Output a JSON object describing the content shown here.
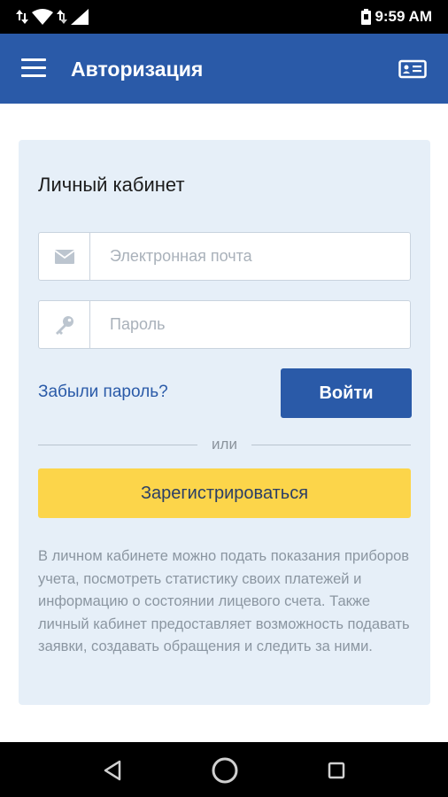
{
  "status_bar": {
    "time": "9:59 AM",
    "icons": [
      "data-arrows-icon",
      "wifi-icon",
      "signal-icon",
      "battery-icon"
    ]
  },
  "app_bar": {
    "title": "Авторизация",
    "menu_icon": "hamburger-menu-icon",
    "action_icon": "id-card-icon",
    "background": "#2a5aa8"
  },
  "login_panel": {
    "title": "Личный кабинет",
    "email": {
      "placeholder": "Электронная почта",
      "value": "",
      "icon": "envelope-icon"
    },
    "password": {
      "placeholder": "Пароль",
      "value": "",
      "icon": "key-icon"
    },
    "forgot_link": "Забыли пароль?",
    "login_button": "Войти",
    "divider_text": "или",
    "register_button": "Зарегистрироваться",
    "info_text": "В личном кабинете можно подать показания приборов учета, посмотреть статистику своих платежей и информацию о состоянии лицевого счета. Также личный кабинет предоставляет возможность подавать заявки, создавать обращения и следить за ними."
  },
  "nav_bar": {
    "icons": [
      "back-icon",
      "home-icon",
      "recent-apps-icon"
    ]
  },
  "colors": {
    "primary": "#2a5aa8",
    "accent": "#fcd54a",
    "panel_bg": "#e6eff8"
  }
}
